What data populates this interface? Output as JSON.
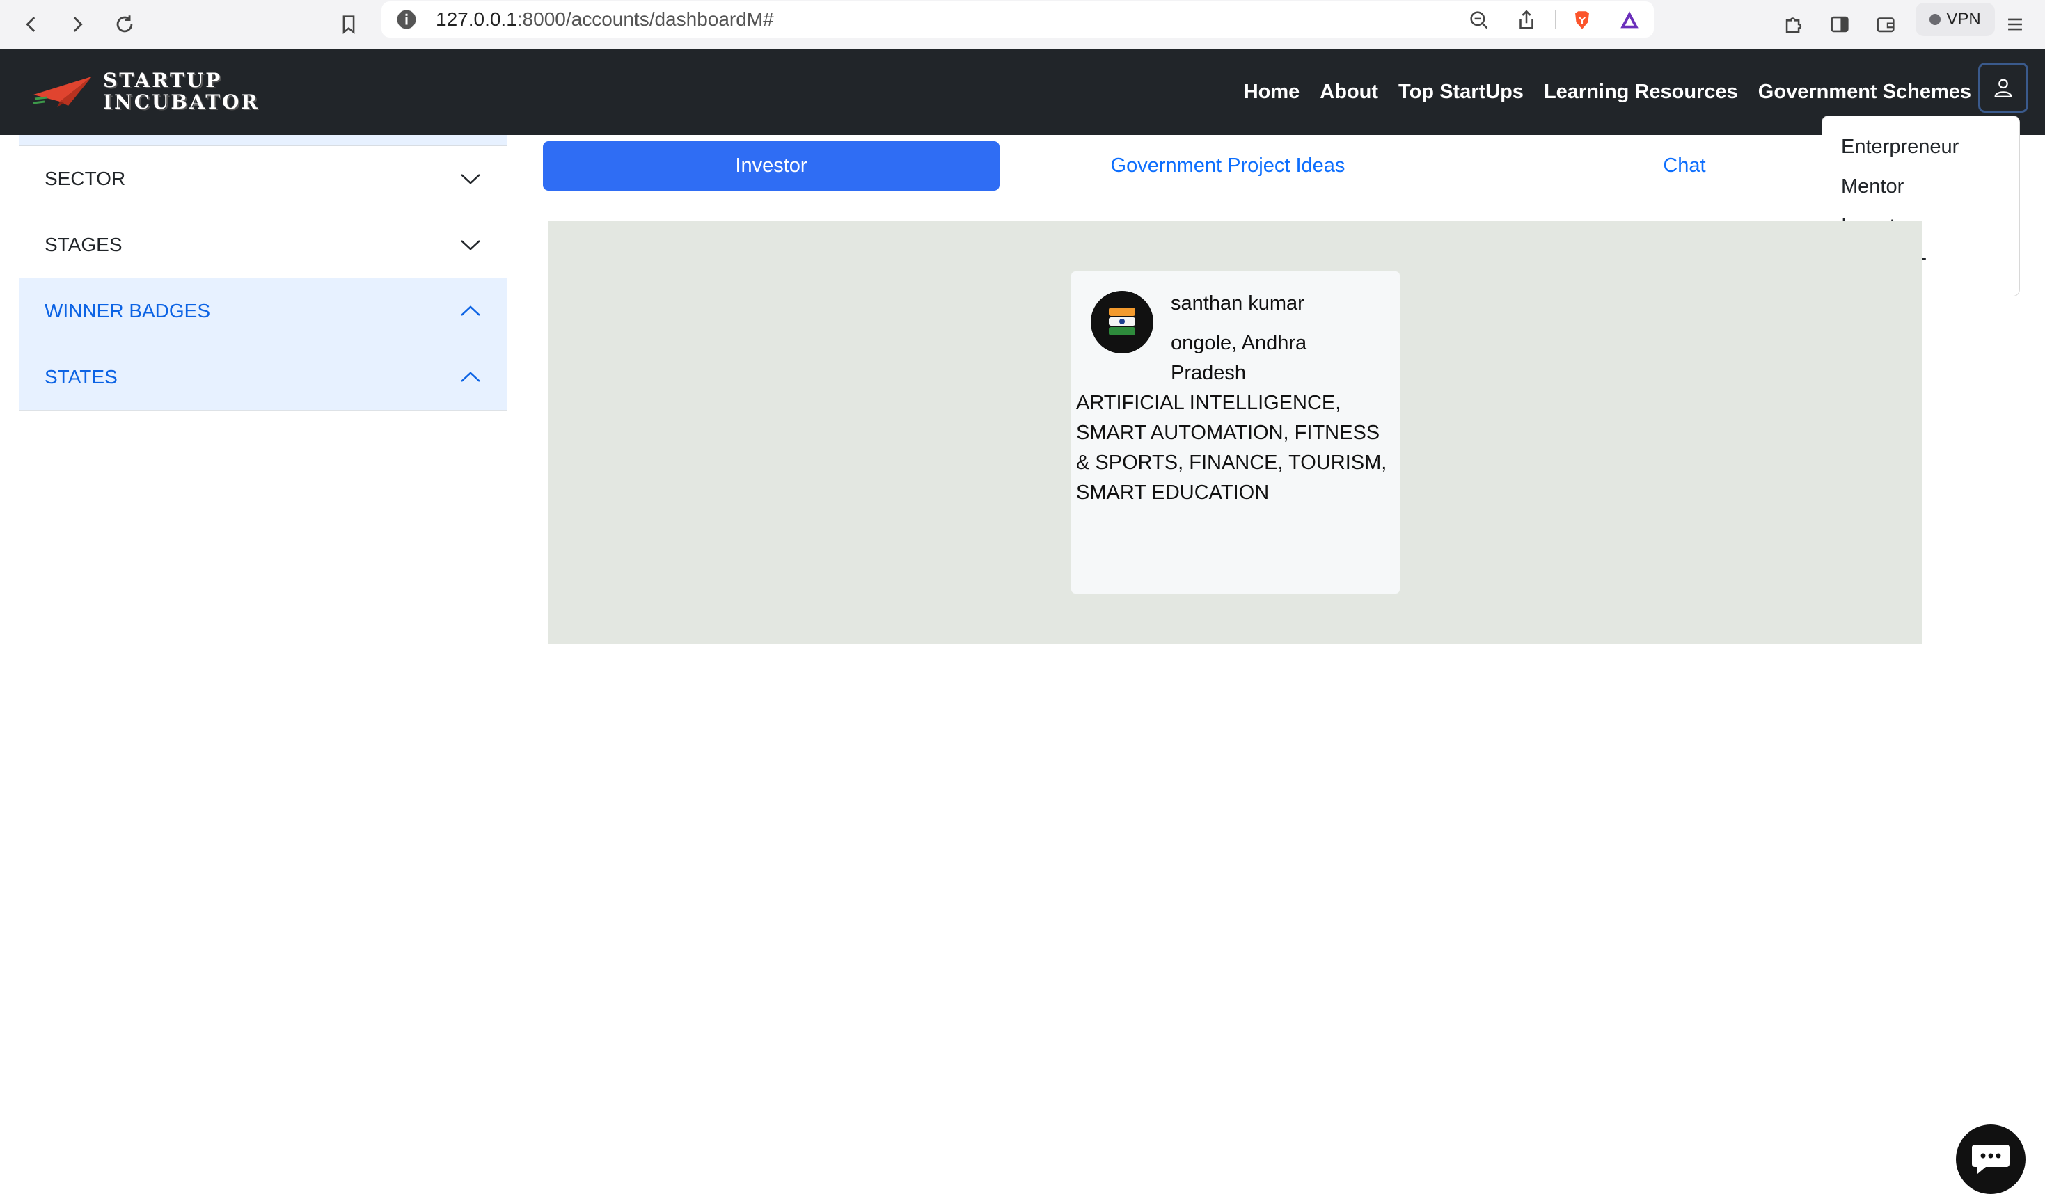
{
  "browser": {
    "url_host": "127.0.0.1",
    "url_rest": ":8000/accounts/dashboardM#",
    "vpn_label": "VPN"
  },
  "navbar": {
    "brand_line1": "STARTUP",
    "brand_line2": "INCUBATOR",
    "links": [
      "Home",
      "About",
      "Top StartUps",
      "Learning Resources",
      "Government Schemes"
    ]
  },
  "user_menu": {
    "items": [
      "Enterpreneur",
      "Mentor",
      "Investor",
      "LOGOUT"
    ]
  },
  "sidebar": {
    "items": [
      {
        "label": "SECTOR",
        "state": "collapsed"
      },
      {
        "label": "STAGES",
        "state": "collapsed"
      },
      {
        "label": "WINNER BADGES",
        "state": "expanded"
      },
      {
        "label": "STATES",
        "state": "expanded"
      }
    ]
  },
  "tabs": [
    {
      "label": "Investor",
      "active": true
    },
    {
      "label": "Government Project Ideas",
      "active": false
    },
    {
      "label": "Chat",
      "active": false
    }
  ],
  "card": {
    "name": "santhan kumar",
    "location": "ongole, Andhra Pradesh",
    "sectors": "ARTIFICIAL INTELLIGENCE, SMART AUTOMATION, FITNESS & SPORTS, FINANCE, TOURISM, SMART EDUCATION"
  },
  "colors": {
    "navbar_bg": "#212529",
    "tab_active_bg": "#2f6df4",
    "link_blue": "#0d6efd",
    "content_bg": "#e3e7e1"
  }
}
